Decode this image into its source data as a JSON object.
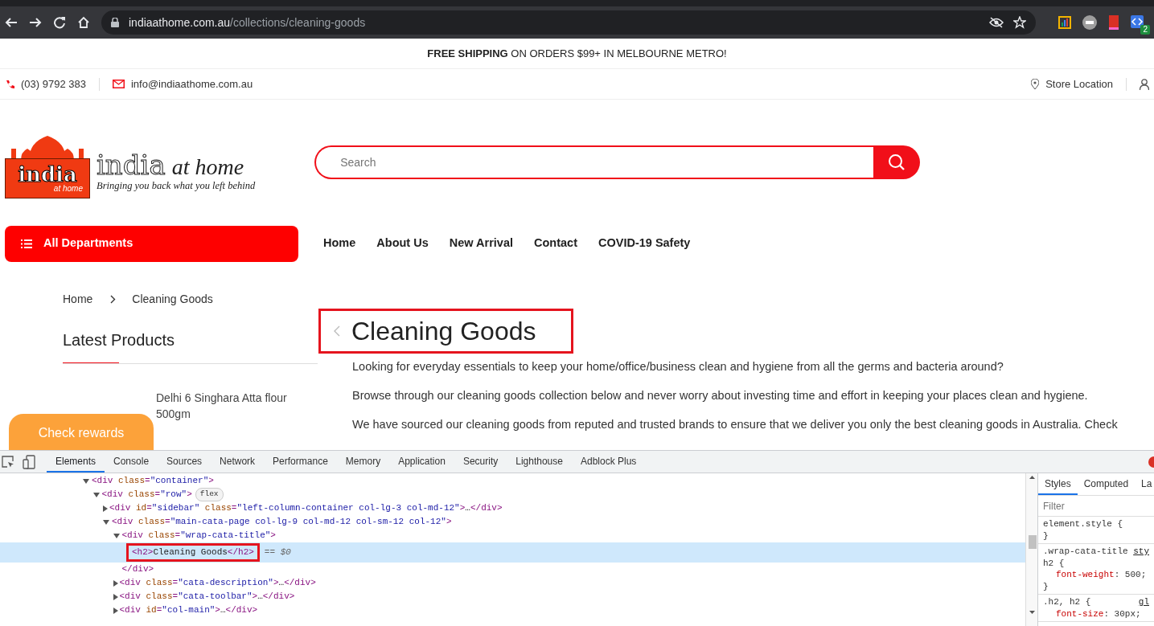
{
  "browser": {
    "url_host": "indiaathome.com.au",
    "url_path": "/collections/cleaning-goods",
    "extension_badge": "2"
  },
  "announcement": "**FREE SHIPPING** ON ORDERS $99+ IN MELBOURNE METRO!",
  "contact": {
    "phone": "(03) 9792 383",
    "email": "info@indiaathome.com.au",
    "store": "Store Location"
  },
  "logo": {
    "emblem_word": "india",
    "emblem_sub": "at home",
    "name_word": "india",
    "name_rest": "at home",
    "tagline": "Bringing you back what you left behind"
  },
  "search": {
    "placeholder": "Search"
  },
  "departments": "All Departments",
  "nav": [
    "Home",
    "About Us",
    "New Arrival",
    "Contact",
    "COVID-19 Safety"
  ],
  "breadcrumb": [
    "Home",
    "Cleaning Goods"
  ],
  "sidebar": {
    "title": "Latest Products",
    "products": [
      {
        "name": "Delhi 6 Singhara Atta flour 500gm"
      }
    ]
  },
  "rewards": "Check rewards",
  "category": {
    "title": "Cleaning Goods",
    "annotated": true,
    "paragraphs": [
      "Looking for everyday essentials to keep your home/office/business clean and hygiene from all the germs and bacteria around?",
      "Browse through our cleaning goods collection below and never worry about investing time and effort in keeping your places clean and hygiene.",
      "We have sourced our cleaning goods from reputed and trusted brands to ensure that we deliver you only the best cleaning goods in Australia. Check"
    ]
  },
  "devtools": {
    "tabs": [
      {
        "label": "Elements",
        "selected": true
      },
      {
        "label": "Console",
        "selected": false
      },
      {
        "label": "Sources",
        "selected": false
      },
      {
        "label": "Network",
        "selected": false
      },
      {
        "label": "Performance",
        "selected": false
      },
      {
        "label": "Memory",
        "selected": false
      },
      {
        "label": "Application",
        "selected": false
      },
      {
        "label": "Security",
        "selected": false
      },
      {
        "label": "Lighthouse",
        "selected": false
      },
      {
        "label": "Adblock Plus",
        "selected": false
      }
    ],
    "dom": [
      {
        "text": "<div class=\"container\">",
        "expanded": true,
        "selected": false,
        "children": [
          {
            "text": "<div class=\"row\">",
            "badge": "flex",
            "expanded": true,
            "selected": false,
            "children": [
              {
                "text": "<div id=\"sidebar\" class=\"left-column-container col-lg-3 col-md-12\">…</div>",
                "expanded": false,
                "selected": false
              },
              {
                "text": "<div class=\"main-cata-page col-lg-9 col-md-12 col-sm-12 col-12\">",
                "expanded": true,
                "selected": false,
                "children": [
                  {
                    "text": "<div class=\"wrap-cata-title\">",
                    "expanded": true,
                    "selected": false,
                    "close": "</div>",
                    "children": [
                      {
                        "text": "<h2>Cleaning Goods</h2>",
                        "note": "== $0",
                        "selected": true,
                        "annotated": true
                      }
                    ]
                  },
                  {
                    "text": "<div class=\"cata-description\">…</div>",
                    "expanded": false,
                    "selected": false
                  },
                  {
                    "text": "<div class=\"cata-toolbar\">…</div>",
                    "expanded": false,
                    "selected": false
                  },
                  {
                    "text": "<div id=\"col-main\">…</div>",
                    "expanded": false,
                    "selected": false
                  }
                ]
              }
            ]
          }
        ]
      }
    ],
    "side_tabs": [
      {
        "label": "Styles",
        "selected": true
      },
      {
        "label": "Computed",
        "selected": false
      },
      {
        "label": "La",
        "selected": false
      }
    ],
    "filter_placeholder": "Filter",
    "rules": [
      {
        "selector": "element.style {",
        "close": "}"
      },
      {
        "selector": ".wrap-cata-title h2 {",
        "source": "sty",
        "props": [
          "font-weight: 500;"
        ],
        "close": "}"
      },
      {
        "selector": ".h2, h2 {",
        "source": "gl",
        "props": [
          "font-size: 30px;"
        ]
      }
    ]
  }
}
